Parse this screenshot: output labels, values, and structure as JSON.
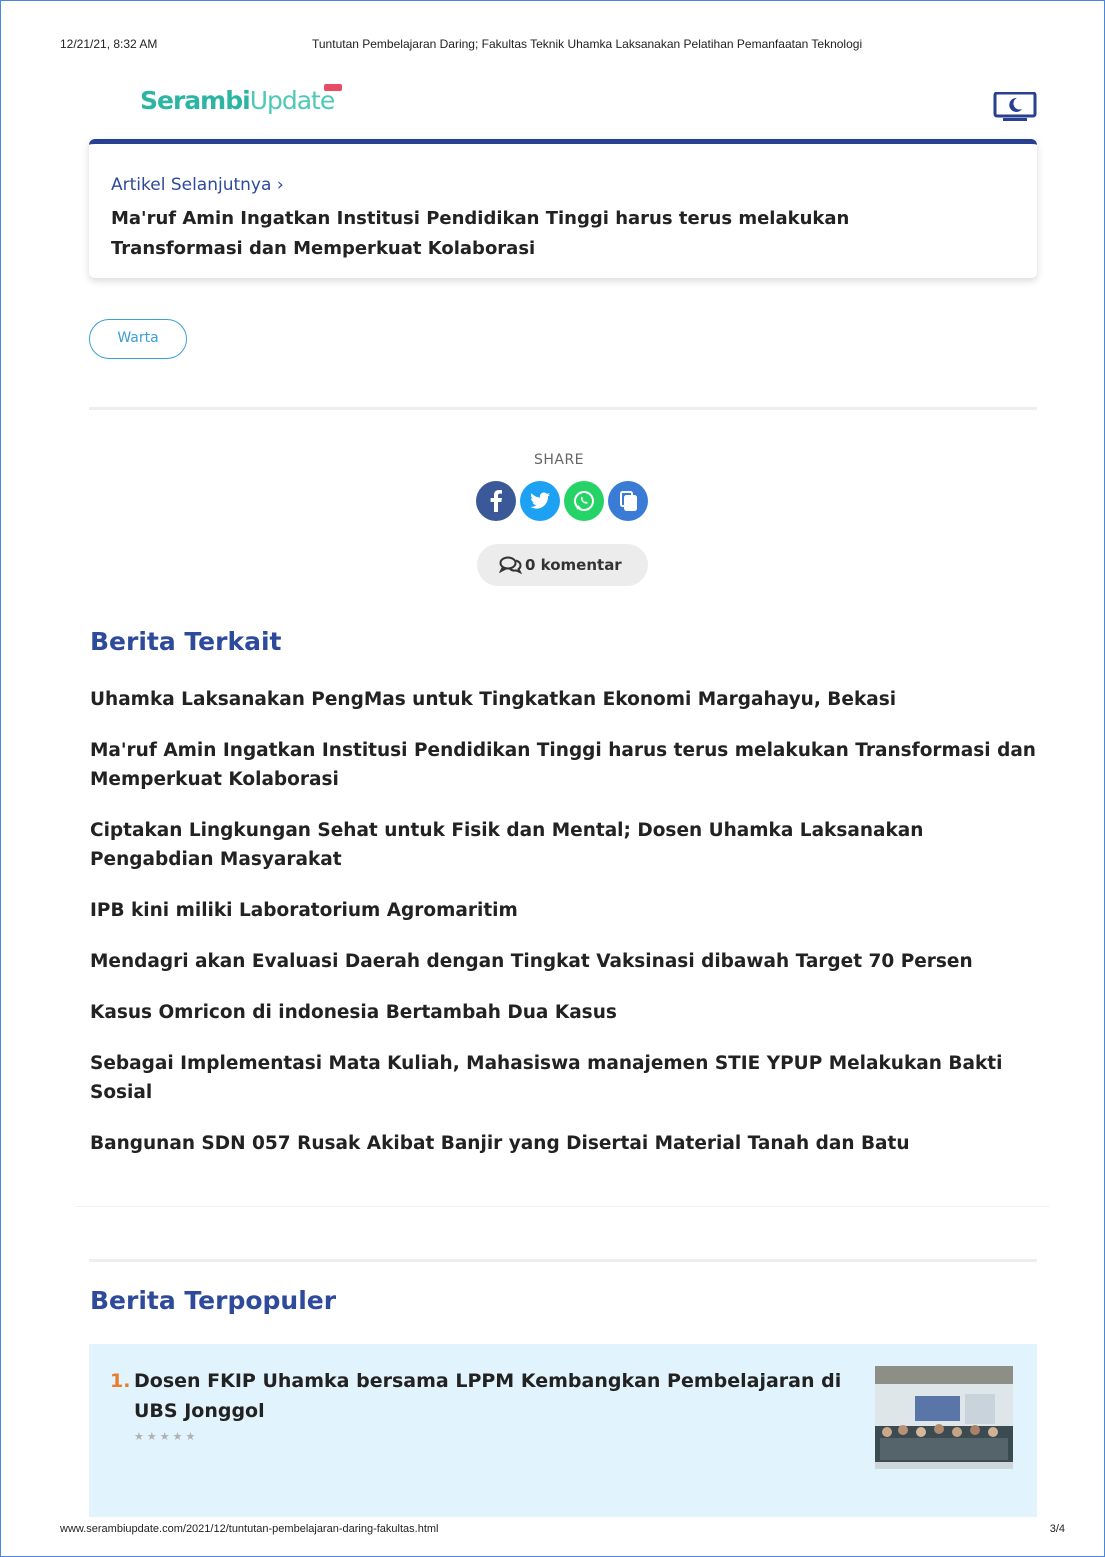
{
  "print": {
    "date": "12/21/21, 8:32 AM",
    "doc_title": "Tuntutan Pembelajaran Daring; Fakultas Teknik Uhamka Laksanakan Pelatihan Pemanfaatan Teknologi",
    "url": "www.serambiupdate.com/2021/12/tuntutan-pembelajaran-daring-fakultas.html",
    "page": "3/4"
  },
  "header": {
    "logo_bold": "Serambi",
    "logo_light": "Update",
    "mode_icon": "moon-monitor-icon"
  },
  "next_article": {
    "label": "Artikel Selanjutnya ›",
    "title": "Ma'ruf Amin Ingatkan Institusi Pendidikan Tinggi harus terus melakukan Transformasi dan Memperkuat Kolaborasi"
  },
  "tag": "Warta",
  "share": {
    "label": "SHARE",
    "buttons": [
      {
        "name": "facebook",
        "icon": "facebook-icon",
        "color": "#3b5998"
      },
      {
        "name": "twitter",
        "icon": "twitter-icon",
        "color": "#1da1f2"
      },
      {
        "name": "whatsapp",
        "icon": "whatsapp-icon",
        "color": "#25d366"
      },
      {
        "name": "copy",
        "icon": "copy-icon",
        "color": "#3a7bd5"
      }
    ]
  },
  "comments": {
    "label": "0 komentar",
    "icon": "comments-icon"
  },
  "related": {
    "title": "Berita Terkait",
    "items": [
      "Uhamka Laksanakan PengMas untuk Tingkatkan Ekonomi Margahayu, Bekasi",
      "Ma'ruf Amin Ingatkan Institusi Pendidikan Tinggi harus terus melakukan Transformasi dan Memperkuat Kolaborasi",
      "Ciptakan Lingkungan Sehat untuk Fisik dan Mental; Dosen Uhamka Laksanakan Pengabdian Masyarakat",
      "IPB kini miliki Laboratorium Agromaritim",
      "Mendagri akan Evaluasi Daerah dengan Tingkat Vaksinasi dibawah Target 70 Persen",
      "Kasus Omricon di indonesia Bertambah Dua Kasus",
      "Sebagai Implementasi Mata Kuliah, Mahasiswa manajemen STIE YPUP Melakukan Bakti Sosial",
      "Bangunan SDN 057 Rusak Akibat Banjir yang Disertai Material Tanah dan Batu"
    ]
  },
  "popular": {
    "title": "Berita Terpopuler",
    "items": [
      {
        "rank": "1.",
        "title": "Dosen FKIP Uhamka bersama LPPM Kembangkan Pembelajaran di UBS Jonggol",
        "stars": "★★★★★"
      }
    ]
  }
}
